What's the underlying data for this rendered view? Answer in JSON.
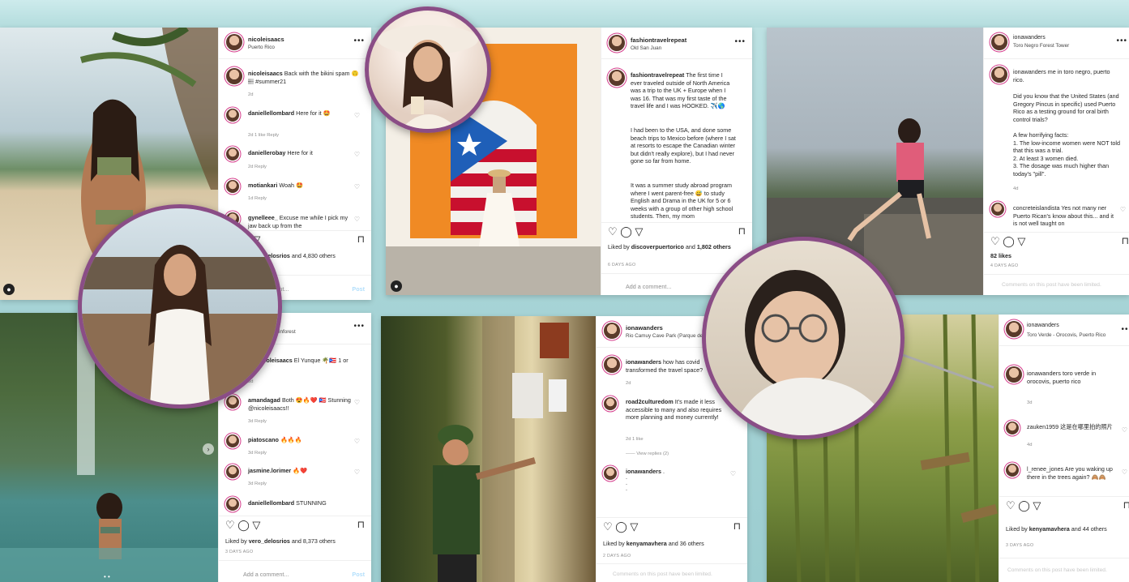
{
  "posts": {
    "p1": {
      "username": "nicoleisaacs",
      "location": "Puerto Rico",
      "caption_user": "nicoleisaacs",
      "caption": "Back with the bikini spam 🙃🏽 #summer21",
      "caption_age": "2d",
      "comments": [
        {
          "user": "daniellellombard",
          "text": "Here for it 🤩",
          "meta": "2d   1 like   Reply"
        },
        {
          "user": "daniellerobay",
          "text": "Here for it",
          "meta": "2d   Reply"
        },
        {
          "user": "motiankari",
          "text": "Woah 🤩",
          "meta": "1d   Reply"
        },
        {
          "user": "gynelleee_",
          "text": "Excuse me while I pick my jaw back up from the",
          "meta": ""
        }
      ],
      "liked_by_user": "vero_delosrios",
      "liked_by_rest": "and 4,830 others",
      "add_comment": "Add a comment...",
      "post_button": "Post"
    },
    "p2": {
      "username": "fashiontravelrepeat",
      "location": "Old San Juan",
      "caption_user": "fashiontravelrepeat",
      "caption_1": "The first time I ever traveled outside of North America was a trip to the UK + Europe when I was 16. That was my first taste of the travel life and I was HOOKED. ✈️🌎",
      "caption_2": "I had been to the USA, and done some beach trips to Mexico before (where I sat at resorts to escape the Canadian winter but didn't really explore), but I had never gone so far from home.",
      "caption_3": "It was a summer study abroad program where I went parent-free 😅 to study English and Drama in the UK for 5 or 6 weeks with a group of other high school students. Then, my mom",
      "liked_by_prefix": "Liked by",
      "liked_by_user": "discoverpuertorico",
      "liked_by_rest": "and",
      "likes_count": "1,802 others",
      "ago": "6 DAYS AGO",
      "add_comment": "Add a comment..."
    },
    "p3": {
      "username": "ionawanders",
      "location": "Toro Negro Forest Tower",
      "caption_user": "ionawanders",
      "caption_1": "me in toro negro, puerto rico.",
      "caption_2": "Did you know that the United States (and Gregory Pincus in specific) used Puerto Rico as a testing ground for oral birth control trials?",
      "caption_3": "A few horrifying facts:\n1. The low-income women were NOT told that this was a trial.\n2. At least 3 women died.\n3. The dosage was much higher than today's \"pill\".",
      "caption_age": "4d",
      "comments": [
        {
          "user": "concreteislandista",
          "text": "Yes not many ner Puerto Rican's know about this... and it is not well taught on"
        }
      ],
      "likes": "82 likes",
      "ago": "4 DAYS AGO",
      "limited": "Comments on this post have been limited."
    },
    "p4": {
      "username": "nicoleisaacs",
      "location": "Rainforest",
      "caption_user": "nicoleisaacs",
      "caption": "El Yunque 🌴🇵🇷 1 or",
      "caption_age": "3d",
      "comments": [
        {
          "user": "amandagad",
          "text": "Both 😍🔥❤️ 🇵🇷 Stunning @nicoleisaacs!!",
          "meta": "3d   Reply"
        },
        {
          "user": "piatoscano",
          "text": "🔥🔥🔥",
          "meta": "3d   Reply"
        },
        {
          "user": "jasmine.lorimer",
          "text": "🔥❤️",
          "meta": "3d   Reply"
        },
        {
          "user": "daniellellombard",
          "text": "STUNNING",
          "meta": ""
        }
      ],
      "liked_by_user": "vero_delosrios",
      "liked_by_rest": "and 8,373 others",
      "ago": "3 DAYS AGO",
      "add_comment": "Add a comment...",
      "post_button": "Post"
    },
    "p5": {
      "username": "ionawanders",
      "location": "Rio Camuy Cave Park (Parque de",
      "caption_user": "ionawanders",
      "caption": "how has covid transformed the travel space?",
      "caption_age": "2d",
      "comments": [
        {
          "user": "road2culturedom",
          "text": "It's made it less accessible to many and also requires more planning and money currently!",
          "meta": "2d   1 like"
        },
        {
          "user": "ionawanders",
          "text": ".\n.\n.\n.",
          "meta": ""
        }
      ],
      "view_replies": "View replies (2)",
      "liked_by_user": "kenyamavhera",
      "liked_by_rest": "and 36 others",
      "ago": "2 DAYS AGO",
      "limited": "Comments on this post have been limited."
    },
    "p6": {
      "username": "ionawanders",
      "location": "Toro Verde - Orocovis, Puerto Rico",
      "caption_user": "ionawanders",
      "caption": "toro verde in orocovis, puerto rico",
      "caption_age": "3d",
      "comments": [
        {
          "user": "zauken1959",
          "text": "这是在哪里拍的照片",
          "meta": "4d"
        },
        {
          "user": "l_renee_jones",
          "text": "Are you waking up there in the trees again? 🙈🙈",
          "meta": ""
        }
      ],
      "liked_by_user": "kenyamavhera",
      "liked_by_rest": "and 44 others",
      "ago": "3 DAYS AGO",
      "limited": "Comments on this post have been limited."
    }
  },
  "common": {
    "more": "•••",
    "heart": "♡",
    "actions": "♡  ◯  ▽",
    "bookmark": "⊓",
    "liked_by": "Liked by"
  }
}
